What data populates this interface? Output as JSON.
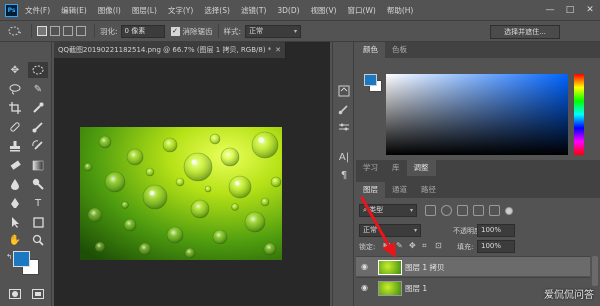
{
  "app": {
    "logo": "Ps"
  },
  "menu": [
    "文件(F)",
    "编辑(E)",
    "图像(I)",
    "图层(L)",
    "文字(Y)",
    "选择(S)",
    "滤镜(T)",
    "3D(D)",
    "视图(V)",
    "窗口(W)",
    "帮助(H)"
  ],
  "window_controls": {
    "minimize": "—",
    "maximize": "□",
    "close": "✕"
  },
  "options": {
    "feather_label": "羽化:",
    "feather_value": "0 像素",
    "antialias_label": "消除锯齿",
    "antialias_checked": "✓",
    "style_label": "样式:",
    "style_value": "正常",
    "select_mask": "选择并遮住..."
  },
  "document": {
    "tab_title": "QQ截图20190221182514.png @ 66.7% (图层 1 拷贝, RGB/8) *",
    "close": "✕"
  },
  "color_panel": {
    "tabs": [
      "颜色",
      "色板"
    ],
    "foreground_color": "#1c79c1",
    "background_color": "#ffffff"
  },
  "lib_panel": {
    "tabs": [
      "学习",
      "库",
      "调整"
    ]
  },
  "layers_panel": {
    "tabs": [
      "图层",
      "通道",
      "路径"
    ],
    "kind_filter": "类型",
    "blend_mode": "正常",
    "opacity_label": "不透明度:",
    "opacity_value": "100%",
    "lock_label": "锁定:",
    "fill_label": "填充:",
    "fill_value": "100%",
    "layers": [
      {
        "name": "图层 1 拷贝",
        "selected": true
      },
      {
        "name": "图层 1",
        "selected": false
      }
    ]
  },
  "watermark": "爱侃侃问答",
  "icons": {
    "eye": "eye-icon",
    "arrow": "red-annotation-arrow"
  }
}
